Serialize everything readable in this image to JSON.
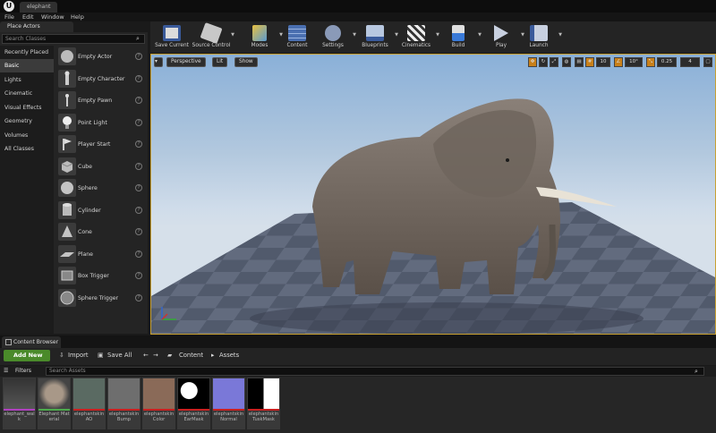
{
  "title_bar": {
    "document_tab": "elephant"
  },
  "menu": [
    "File",
    "Edit",
    "Window",
    "Help"
  ],
  "place_actors": {
    "tab_label": "Place Actors",
    "search_placeholder": "Search Classes",
    "categories": [
      "Recently Placed",
      "Basic",
      "Lights",
      "Cinematic",
      "Visual Effects",
      "Geometry",
      "Volumes",
      "All Classes"
    ],
    "selected_category": "Basic",
    "actors": [
      "Empty Actor",
      "Empty Character",
      "Empty Pawn",
      "Point Light",
      "Player Start",
      "Cube",
      "Sphere",
      "Cylinder",
      "Cone",
      "Plane",
      "Box Trigger",
      "Sphere Trigger"
    ]
  },
  "toolbar": {
    "buttons": [
      "Save Current",
      "Source Control",
      "Modes",
      "Content",
      "Settings",
      "Blueprints",
      "Cinematics",
      "Build",
      "Play",
      "Launch"
    ]
  },
  "viewport": {
    "perspective": "Perspective",
    "lit": "Lit",
    "show": "Show",
    "grid_snap": "10",
    "rotation_snap": "10°",
    "scale_snap": "0.25",
    "camera_speed": "4"
  },
  "content_browser": {
    "tab_label": "Content Browser",
    "add_new": "Add New",
    "import": "Import",
    "save_all": "Save All",
    "breadcrumb": [
      "Content",
      "Assets"
    ],
    "filters": "Filters",
    "search_placeholder": "Search Assets",
    "assets": [
      "elephant_walk",
      "Elephant Material",
      "elephantskin AO",
      "elephantskin Bump",
      "elephantskin Color",
      "elephantskin EarMask",
      "elephantskin Normal",
      "elephantskin TuskMask"
    ]
  },
  "colors": {
    "accent_green": "#4a8a2a",
    "viewport_border": "#c8a030",
    "bg_dark": "#1a1a1a"
  }
}
